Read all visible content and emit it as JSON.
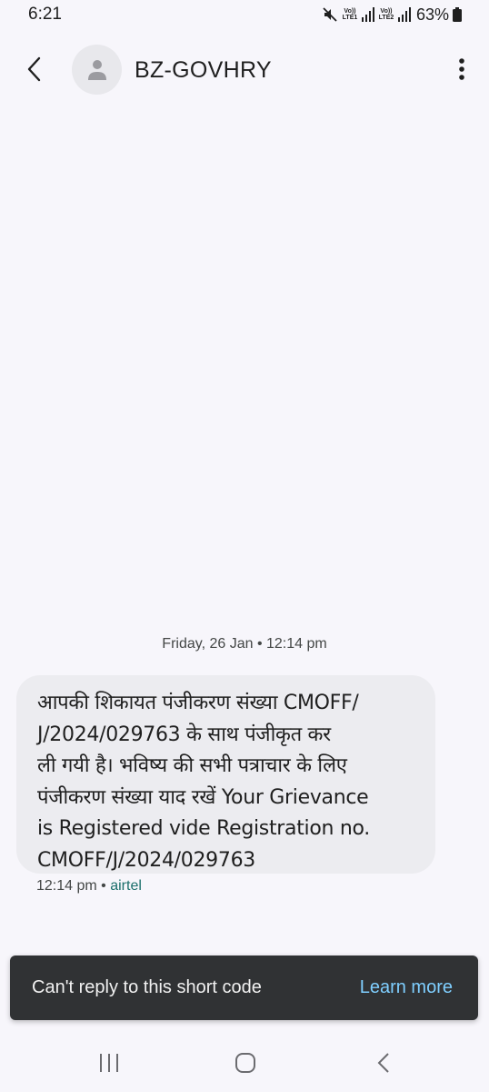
{
  "status_bar": {
    "time": "6:21",
    "sim1_label_top": "Vo))",
    "sim1_label_bottom": "LTE1",
    "sim2_label_top": "Vo))",
    "sim2_label_bottom": "LTE2",
    "battery": "63%"
  },
  "app_bar": {
    "contact_name": "BZ-GOVHRY"
  },
  "conversation": {
    "date_divider": "Friday, 26 Jan • 12:14 pm",
    "message": {
      "lines": [
        "आपकी शिकायत पंजीकरण संख्या CMOFF/",
        "J/2024/029763 के साथ पंजीकृत कर",
        "ली गयी है। भविष्य की सभी पत्राचार के लिए",
        "पंजीकरण संख्या याद रखें Your Grievance",
        "is Registered vide Registration no.",
        "CMOFF/J/2024/029763"
      ],
      "time": "12:14 pm",
      "separator": " • ",
      "carrier": "airtel"
    }
  },
  "snackbar": {
    "text": "Can't reply to this short code",
    "action": "Learn more"
  },
  "colors": {
    "background": "#f7f6fb",
    "bubble": "#ececf0",
    "snackbar": "#303234",
    "snackbar_action": "#7fcfff",
    "carrier": "#1b6f6b"
  }
}
